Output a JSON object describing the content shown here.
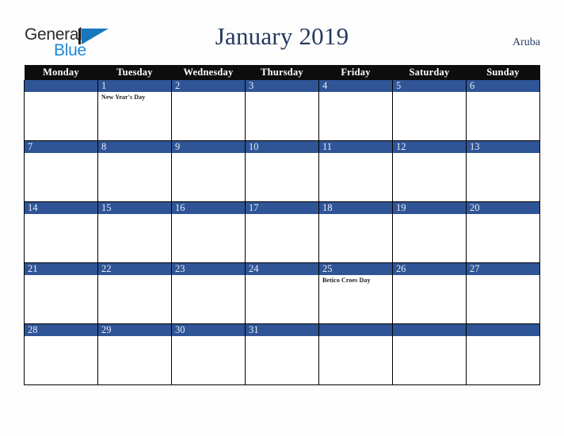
{
  "brand": {
    "name_part1": "General",
    "name_part2": "Blue",
    "color_dark": "#2b2b2b",
    "color_blue": "#1e8ad6"
  },
  "header": {
    "title": "January 2019",
    "locale": "Aruba",
    "title_color": "#27395e"
  },
  "calendar": {
    "header_bg": "#0d0d0d",
    "daybar_bg": "#2f5597",
    "weekday_headers": [
      "Monday",
      "Tuesday",
      "Wednesday",
      "Thursday",
      "Friday",
      "Saturday",
      "Sunday"
    ],
    "weeks": [
      [
        {
          "day": "",
          "events": []
        },
        {
          "day": "1",
          "events": [
            "New Year's Day"
          ]
        },
        {
          "day": "2",
          "events": []
        },
        {
          "day": "3",
          "events": []
        },
        {
          "day": "4",
          "events": []
        },
        {
          "day": "5",
          "events": []
        },
        {
          "day": "6",
          "events": []
        }
      ],
      [
        {
          "day": "7",
          "events": []
        },
        {
          "day": "8",
          "events": []
        },
        {
          "day": "9",
          "events": []
        },
        {
          "day": "10",
          "events": []
        },
        {
          "day": "11",
          "events": []
        },
        {
          "day": "12",
          "events": []
        },
        {
          "day": "13",
          "events": []
        }
      ],
      [
        {
          "day": "14",
          "events": []
        },
        {
          "day": "15",
          "events": []
        },
        {
          "day": "16",
          "events": []
        },
        {
          "day": "17",
          "events": []
        },
        {
          "day": "18",
          "events": []
        },
        {
          "day": "19",
          "events": []
        },
        {
          "day": "20",
          "events": []
        }
      ],
      [
        {
          "day": "21",
          "events": []
        },
        {
          "day": "22",
          "events": []
        },
        {
          "day": "23",
          "events": []
        },
        {
          "day": "24",
          "events": []
        },
        {
          "day": "25",
          "events": [
            "Betico Croes Day"
          ]
        },
        {
          "day": "26",
          "events": []
        },
        {
          "day": "27",
          "events": []
        }
      ],
      [
        {
          "day": "28",
          "events": []
        },
        {
          "day": "29",
          "events": []
        },
        {
          "day": "30",
          "events": []
        },
        {
          "day": "31",
          "events": []
        },
        {
          "day": "",
          "events": []
        },
        {
          "day": "",
          "events": []
        },
        {
          "day": "",
          "events": []
        }
      ]
    ]
  }
}
